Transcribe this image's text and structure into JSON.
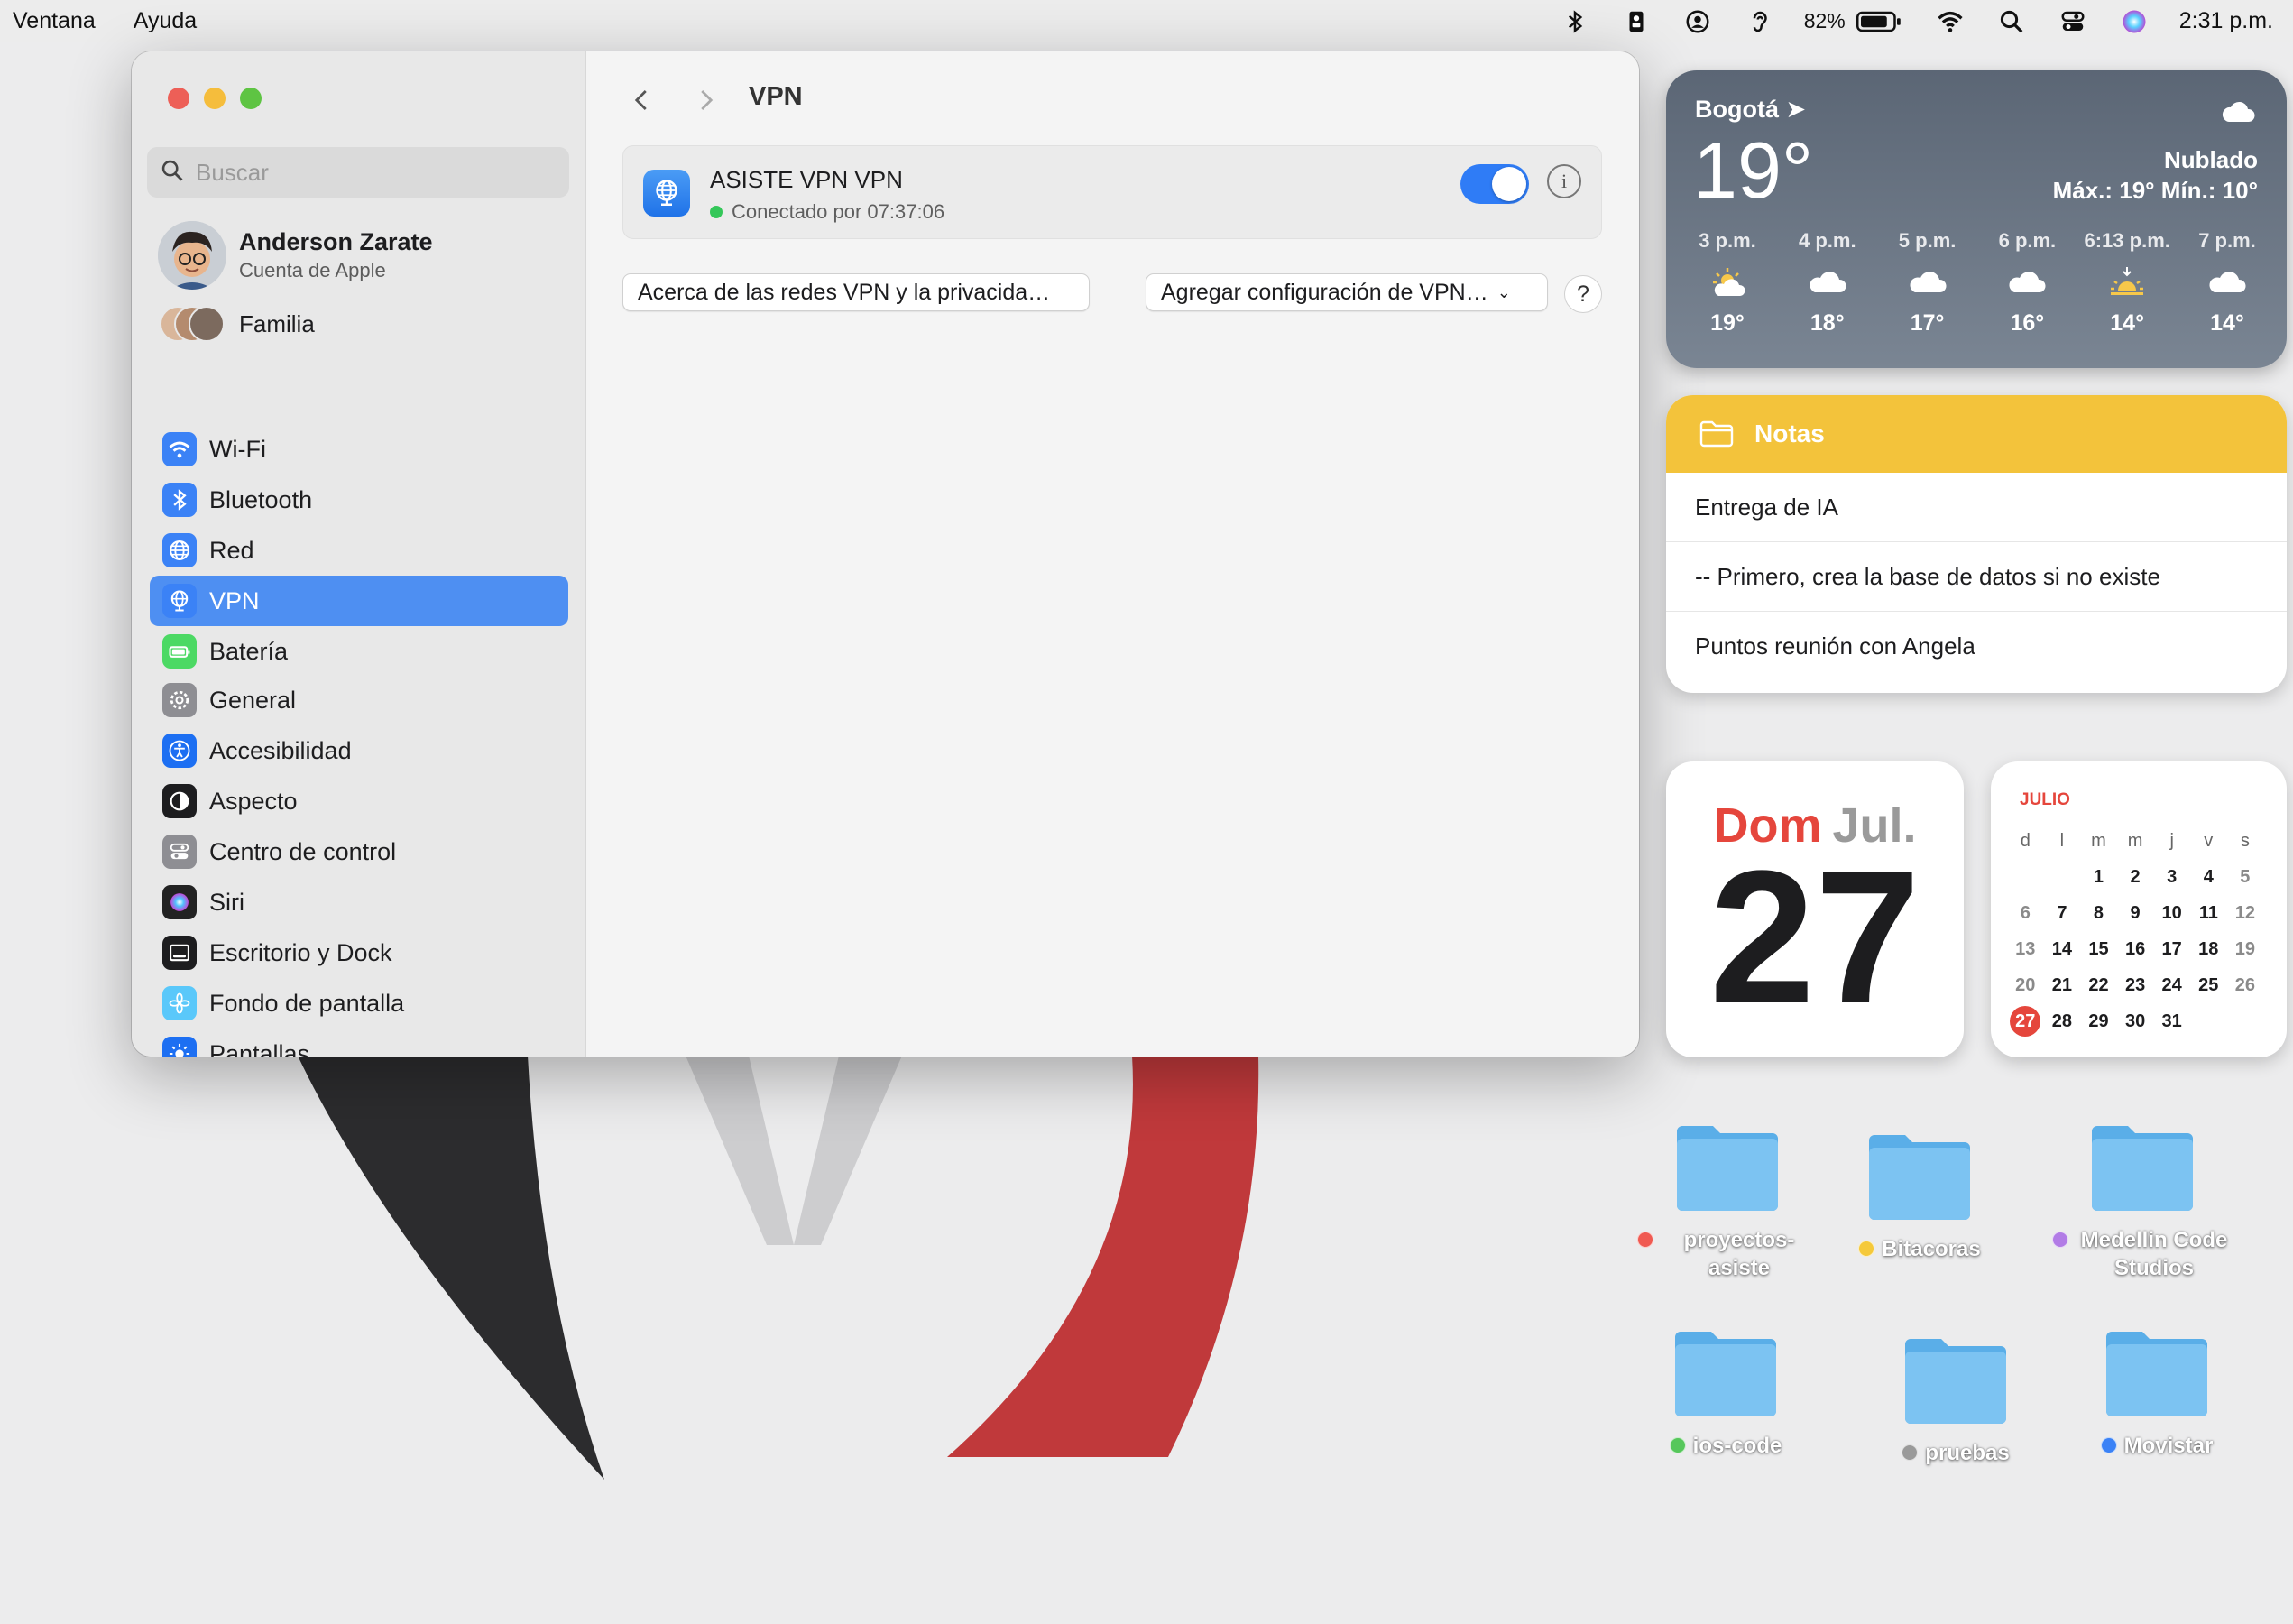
{
  "menubar": {
    "items": [
      "Ventana",
      "Ayuda"
    ],
    "battery_percent": "82%",
    "clock": "2:31 p.m.",
    "icons": [
      "bluetooth-icon",
      "id-card-icon",
      "user-circle-icon",
      "hearing-icon",
      "battery-icon",
      "wifi-icon",
      "search-icon",
      "control-center-icon",
      "siri-icon"
    ]
  },
  "window": {
    "sidebar": {
      "search_placeholder": "Buscar",
      "account": {
        "name": "Anderson Zarate",
        "subtitle": "Cuenta de Apple"
      },
      "family_label": "Familia",
      "group1": [
        {
          "label": "Wi-Fi",
          "icon": "wifi-icon",
          "color": "#3b82f6"
        },
        {
          "label": "Bluetooth",
          "icon": "bluetooth-icon",
          "color": "#3b82f6"
        },
        {
          "label": "Red",
          "icon": "globe-icon",
          "color": "#3b82f6"
        },
        {
          "label": "VPN",
          "icon": "vpn-icon",
          "color": "#3b82f6",
          "active": true
        },
        {
          "label": "Batería",
          "icon": "battery-icon",
          "color": "#4cd964"
        }
      ],
      "group2": [
        {
          "label": "General",
          "icon": "gear-icon",
          "color": "#8e8e93"
        },
        {
          "label": "Accesibilidad",
          "icon": "accessibility-icon",
          "color": "#1d6ff2"
        },
        {
          "label": "Aspecto",
          "icon": "appearance-icon",
          "color": "#1d1d1f"
        },
        {
          "label": "Centro de control",
          "icon": "control-center-icon",
          "color": "#8e8e93"
        },
        {
          "label": "Siri",
          "icon": "siri-icon",
          "color": "#222"
        },
        {
          "label": "Escritorio y Dock",
          "icon": "dock-icon",
          "color": "#1d1d1f"
        },
        {
          "label": "Fondo de pantalla",
          "icon": "wallpaper-icon",
          "color": "#5ac8fa"
        },
        {
          "label": "Pantallas",
          "icon": "display-icon",
          "color": "#1d6ff2"
        }
      ]
    },
    "content": {
      "title": "VPN",
      "vpn": {
        "name": "ASISTE VPN VPN",
        "status": "Conectado por 07:37:06",
        "enabled": true
      },
      "about_button": "Acerca de las redes VPN y la privacida…",
      "add_button": "Agregar configuración de VPN…",
      "help_button": "?"
    }
  },
  "weather": {
    "city": "Bogotá",
    "temp": "19°",
    "condition": "Nublado",
    "range": "Máx.: 19° Mín.: 10°",
    "hours": [
      {
        "time": "3 p.m.",
        "icon": "partly-cloudy-icon",
        "temp": "19°"
      },
      {
        "time": "4 p.m.",
        "icon": "cloud-icon",
        "temp": "18°"
      },
      {
        "time": "5 p.m.",
        "icon": "cloud-icon",
        "temp": "17°"
      },
      {
        "time": "6 p.m.",
        "icon": "cloud-icon",
        "temp": "16°"
      },
      {
        "time": "6:13 p.m.",
        "icon": "sunset-icon",
        "temp": "14°"
      },
      {
        "time": "7 p.m.",
        "icon": "cloud-icon",
        "temp": "14°"
      }
    ]
  },
  "notes": {
    "title": "Notas",
    "items": [
      "Entrega de IA",
      "-- Primero, crea la base de datos si no existe",
      "Puntos reunión con Angela"
    ]
  },
  "calendar_big": {
    "day": "Dom",
    "month": "Jul.",
    "date": "27"
  },
  "calendar_month": {
    "title": "JULIO",
    "weekdays": [
      "d",
      "l",
      "m",
      "m",
      "j",
      "v",
      "s"
    ],
    "weeks": [
      [
        "",
        "",
        "1",
        "2",
        "3",
        "4",
        "5"
      ],
      [
        "6",
        "7",
        "8",
        "9",
        "10",
        "11",
        "12"
      ],
      [
        "13",
        "14",
        "15",
        "16",
        "17",
        "18",
        "19"
      ],
      [
        "20",
        "21",
        "22",
        "23",
        "24",
        "25",
        "26"
      ],
      [
        "27",
        "28",
        "29",
        "30",
        "31",
        "",
        ""
      ]
    ],
    "today": "27"
  },
  "desktop_folders": [
    {
      "label": "proyectos-asiste",
      "tag_color": "#f05a52"
    },
    {
      "label": "Bitacoras",
      "tag_color": "#f5c93a"
    },
    {
      "label": "Medellin Code Studios",
      "tag_color": "#b27ce6"
    },
    {
      "label": "ios-code",
      "tag_color": "#56c75b"
    },
    {
      "label": "pruebas",
      "tag_color": "#9a9a9a"
    },
    {
      "label": "Movistar",
      "tag_color": "#3b82f6"
    }
  ]
}
